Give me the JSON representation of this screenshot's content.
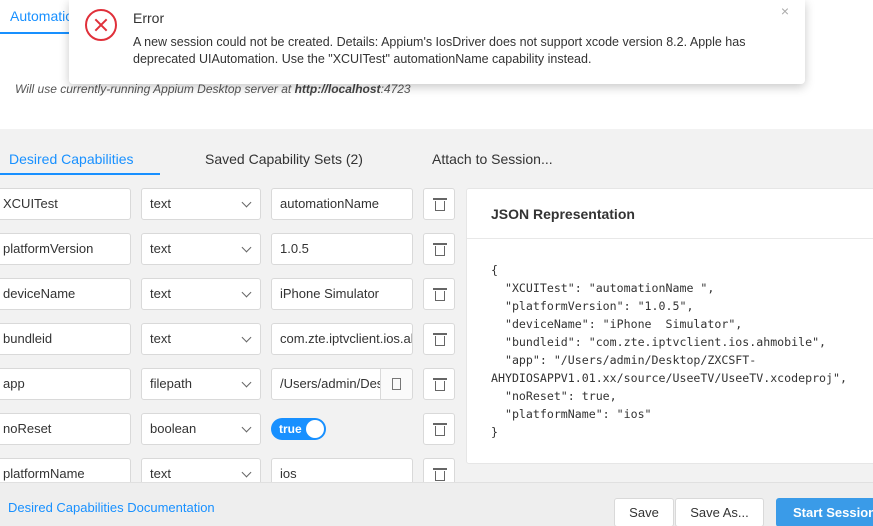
{
  "top_tab": {
    "label": "Automatic"
  },
  "server_note": {
    "prefix": "Will use currently-running Appium Desktop server at ",
    "host": "http://localhost",
    "port": ":4723"
  },
  "error": {
    "title": "Error",
    "message": "A new session could not be created. Details: Appium's IosDriver does not support xcode version 8.2. Apple has deprecated UIAutomation. Use the \"XCUITest\" automationName capability instead.",
    "close": "×"
  },
  "tabs": {
    "desired": "Desired Capabilities",
    "saved": "Saved Capability Sets (2)",
    "attach": "Attach to Session..."
  },
  "capabilities": [
    {
      "name": "XCUITest",
      "type": "text",
      "value": "automationName"
    },
    {
      "name": "platformVersion",
      "type": "text",
      "value": "1.0.5"
    },
    {
      "name": "deviceName",
      "type": "text",
      "value": "iPhone  Simulator"
    },
    {
      "name": "bundleid",
      "type": "text",
      "value": "com.zte.iptvclient.ios.ahmobile"
    },
    {
      "name": "app",
      "type": "filepath",
      "value": "/Users/admin/Desktop"
    },
    {
      "name": "noReset",
      "type": "boolean",
      "value": "true"
    },
    {
      "name": "platformName",
      "type": "text",
      "value": "ios"
    }
  ],
  "json_panel": {
    "title": "JSON Representation",
    "content": "{\n  \"XCUITest\": \"automationName \",\n  \"platformVersion\": \"1.0.5\",\n  \"deviceName\": \"iPhone  Simulator\",\n  \"bundleid\": \"com.zte.iptvclient.ios.ahmobile\",\n  \"app\": \"/Users/admin/Desktop/ZXCSFT-\nAHYDIOSAPPV1.01.xx/source/UseeTV/UseeTV.xcodeproj\",\n  \"noReset\": true,\n  \"platformName\": \"ios\"\n}"
  },
  "footer": {
    "doc_link": "Desired Capabilities Documentation",
    "save": "Save",
    "save_as": "Save As...",
    "start": "Start Session"
  },
  "colors": {
    "accent": "#1890ff",
    "error": "#e0303a",
    "start_button": "#3a9be8"
  }
}
